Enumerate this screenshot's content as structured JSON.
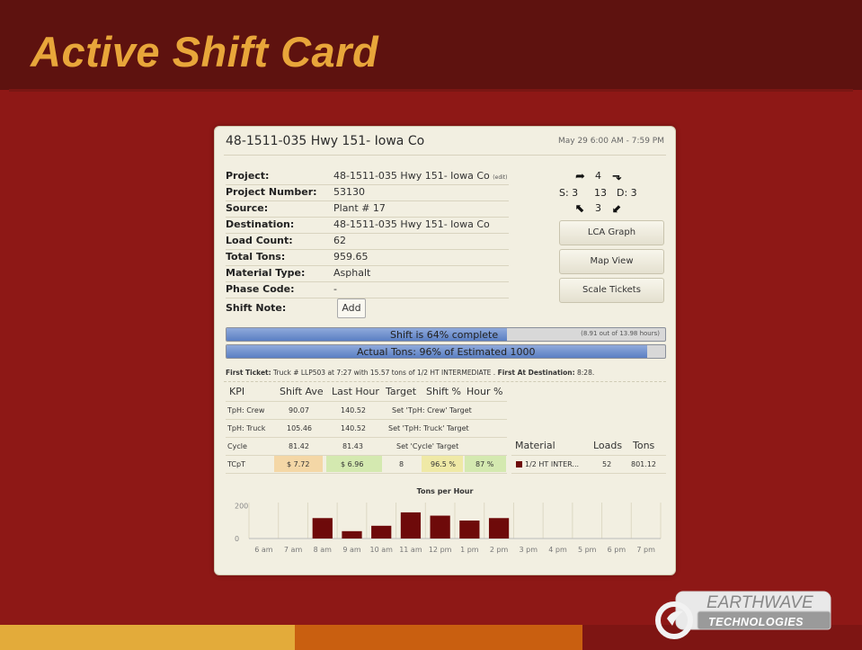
{
  "slide": {
    "title": "Active Shift Card",
    "logo_text_top": "EARTHWAVE",
    "logo_text_bottom": "TECHNOLOGIES"
  },
  "colors": {
    "background": "#8e1816",
    "title_bar": "#5e120f",
    "title_text": "#e8a63a",
    "strip_left": "#e3ab3a",
    "strip_mid": "#c95f10",
    "strip_right": "#7e1513",
    "bar": "#6e0a0a",
    "progress": "#6f8fd0"
  },
  "card": {
    "title": "48-1511-035 Hwy 151- Iowa Co",
    "datetime": "May 29   6:00 AM - 7:59 PM",
    "fields": [
      {
        "label": "Project:",
        "value": "48-1511-035 Hwy 151- Iowa Co",
        "extra": "(edit)"
      },
      {
        "label": "Project Number:",
        "value": "53130"
      },
      {
        "label": "Source:",
        "value": "Plant # 17"
      },
      {
        "label": "Destination:",
        "value": "48-1511-035 Hwy 151- Iowa Co"
      },
      {
        "label": "Load Count:",
        "value": "62"
      },
      {
        "label": "Total Tons:",
        "value": "959.65"
      },
      {
        "label": "Material Type:",
        "value": "Asphalt"
      },
      {
        "label": "Phase Code:",
        "value": "-"
      },
      {
        "label": "Shift Note:",
        "value": ""
      }
    ],
    "add_button": "Add",
    "turns": {
      "top": "4",
      "s_label": "S: 3",
      "center": "13",
      "d_label": "D: 3",
      "bottom": "3"
    },
    "buttons": {
      "lca_graph": "LCA Graph",
      "map_view": "Map View",
      "scale_tickets": "Scale Tickets"
    },
    "shift_progress": {
      "label": "Shift is 64% complete",
      "detail": "(8.91 out of 13.98 hours)",
      "percent": 64
    },
    "tons_progress": {
      "label": "Actual Tons: 96% of Estimated 1000",
      "percent": 96
    },
    "first_ticket": {
      "label": "First Ticket:",
      "text": " Truck # LLP503 at 7:27 with 15.57 tons of 1/2 HT INTERMEDIATE . ",
      "dest_label": "First At Destination:",
      "dest_time": " 8:28."
    },
    "kpi": {
      "headers": [
        "KPI",
        "Shift Ave",
        "Last Hour",
        "Target",
        "Shift %",
        "Hour %"
      ],
      "rows": [
        {
          "name": "TpH: Crew",
          "shift_ave": "90.07",
          "last_hour": "140.52",
          "target_link": "Set 'TpH: Crew' Target"
        },
        {
          "name": "TpH: Truck",
          "shift_ave": "105.46",
          "last_hour": "140.52",
          "target_link": "Set 'TpH: Truck' Target"
        },
        {
          "name": "Cycle",
          "shift_ave": "81.42",
          "last_hour": "81.43",
          "target_link": "Set 'Cycle' Target"
        },
        {
          "name": "TCpT",
          "shift_ave": "$ 7.72",
          "last_hour": "$ 6.96",
          "target": "8",
          "shift_pct": "96.5 %",
          "hour_pct": "87 %"
        }
      ]
    },
    "materials": {
      "headers": [
        "Material",
        "Loads",
        "Tons"
      ],
      "rows": [
        {
          "name": "1/2 HT INTER...",
          "loads": "52",
          "tons": "801.12"
        }
      ]
    }
  },
  "chart_data": {
    "type": "bar",
    "title": "Tons per Hour",
    "categories": [
      "6 am",
      "7 am",
      "8 am",
      "9 am",
      "10 am",
      "11 am",
      "12 pm",
      "1 pm",
      "2 pm",
      "3 pm",
      "4 pm",
      "5 pm",
      "6 pm",
      "7 pm"
    ],
    "values": [
      0,
      0,
      125,
      45,
      78,
      160,
      140,
      110,
      125,
      0,
      0,
      0,
      0,
      0
    ],
    "yticks": [
      0,
      200
    ],
    "ylim": [
      0,
      220
    ],
    "grid": true
  }
}
